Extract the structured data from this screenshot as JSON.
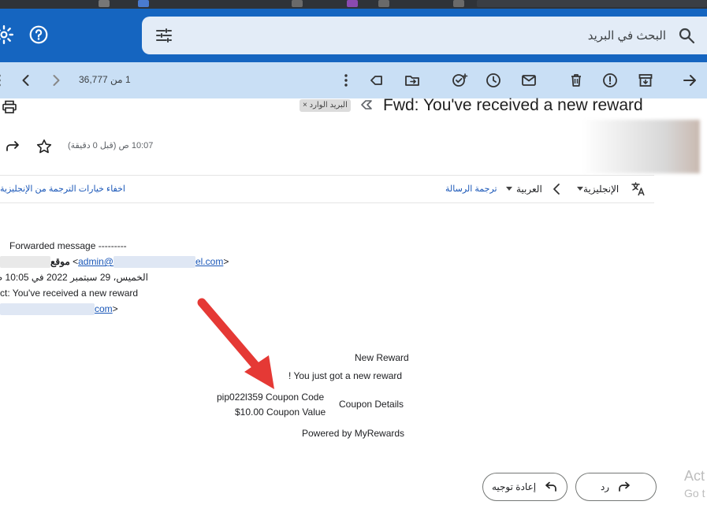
{
  "search": {
    "placeholder": "البحث في البريد"
  },
  "toolbar": {
    "count": "1 من 36,777"
  },
  "message": {
    "subject": "Fwd: You've received a new reward",
    "inbox_badge": "البريد الوارد ×",
    "time": "10:07 ص (قبل 0 دقيقة)"
  },
  "translate": {
    "from_lang": "الإنجليزية",
    "to_lang": "العربية",
    "translate_link": "ترجمة الرسالة",
    "hide_link": "اخفاء خيارات الترجمة من الإنجليزية"
  },
  "forwarded": {
    "header": "Forwarded message ---------",
    "from_label": "موقع",
    "from_email_prefix": "admin@",
    "from_email_suffix": "el.com",
    "date": "الخميس، 29 سبتمبر 2022 في 10:05 ص",
    "subject_line": "ct: You've received a new reward",
    "to_suffix": "com"
  },
  "email_body": {
    "title": "New Reward",
    "line1": "! You just got a new reward",
    "details_label": "Coupon Details",
    "coupon_code_line": "pip022l359 Coupon Code",
    "coupon_value_line": "$10.00 Coupon Value",
    "footer": "Powered by MyRewards"
  },
  "actions": {
    "reply": "رد",
    "forward": "إعادة توجيه"
  },
  "watermark": {
    "line1": "Act",
    "line2": "Go t"
  },
  "colors": {
    "topbar": "#1565c0",
    "toolbar": "#c9dff5",
    "link": "#1a57b8",
    "arrow": "#e53935"
  }
}
